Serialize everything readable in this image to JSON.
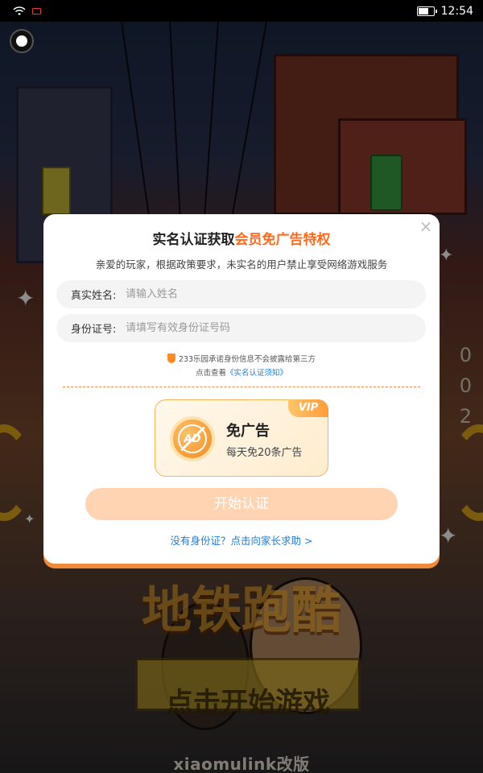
{
  "status_bar": {
    "time": "12:54",
    "icons": [
      "wifi-icon",
      "screen-record-icon",
      "battery-icon"
    ]
  },
  "game": {
    "title_art": "地铁跑酷",
    "start_text": "点击开始游戏",
    "brand": "xiaomulink改版",
    "score_digits": [
      "0",
      "0",
      "2"
    ]
  },
  "dialog": {
    "title_prefix": "实名认证获取",
    "title_highlight": "会员免广告特权",
    "subtitle": "亲爱的玩家，根据政策要求，未实名的用户禁止享受网络游戏服务",
    "name_label": "真实姓名:",
    "name_placeholder": "请输入姓名",
    "id_label": "身份证号:",
    "id_placeholder": "请填写有效身份证号码",
    "promise": "233乐园承诺身份信息不会披露给第三方",
    "notice_prefix": "点击查看",
    "notice_link": "《实名认证须知》",
    "vip_badge": "VIP",
    "ad_icon_text": "AD",
    "vip_title": "免广告",
    "vip_desc": "每天免20条广告",
    "start_button": "开始认证",
    "help_link": "没有身份证？点击向家长求助 >",
    "close": "×"
  },
  "colors": {
    "accent": "#ff6a1a",
    "link": "#1b7ed6",
    "button_disabled": "#ffd4b2"
  }
}
